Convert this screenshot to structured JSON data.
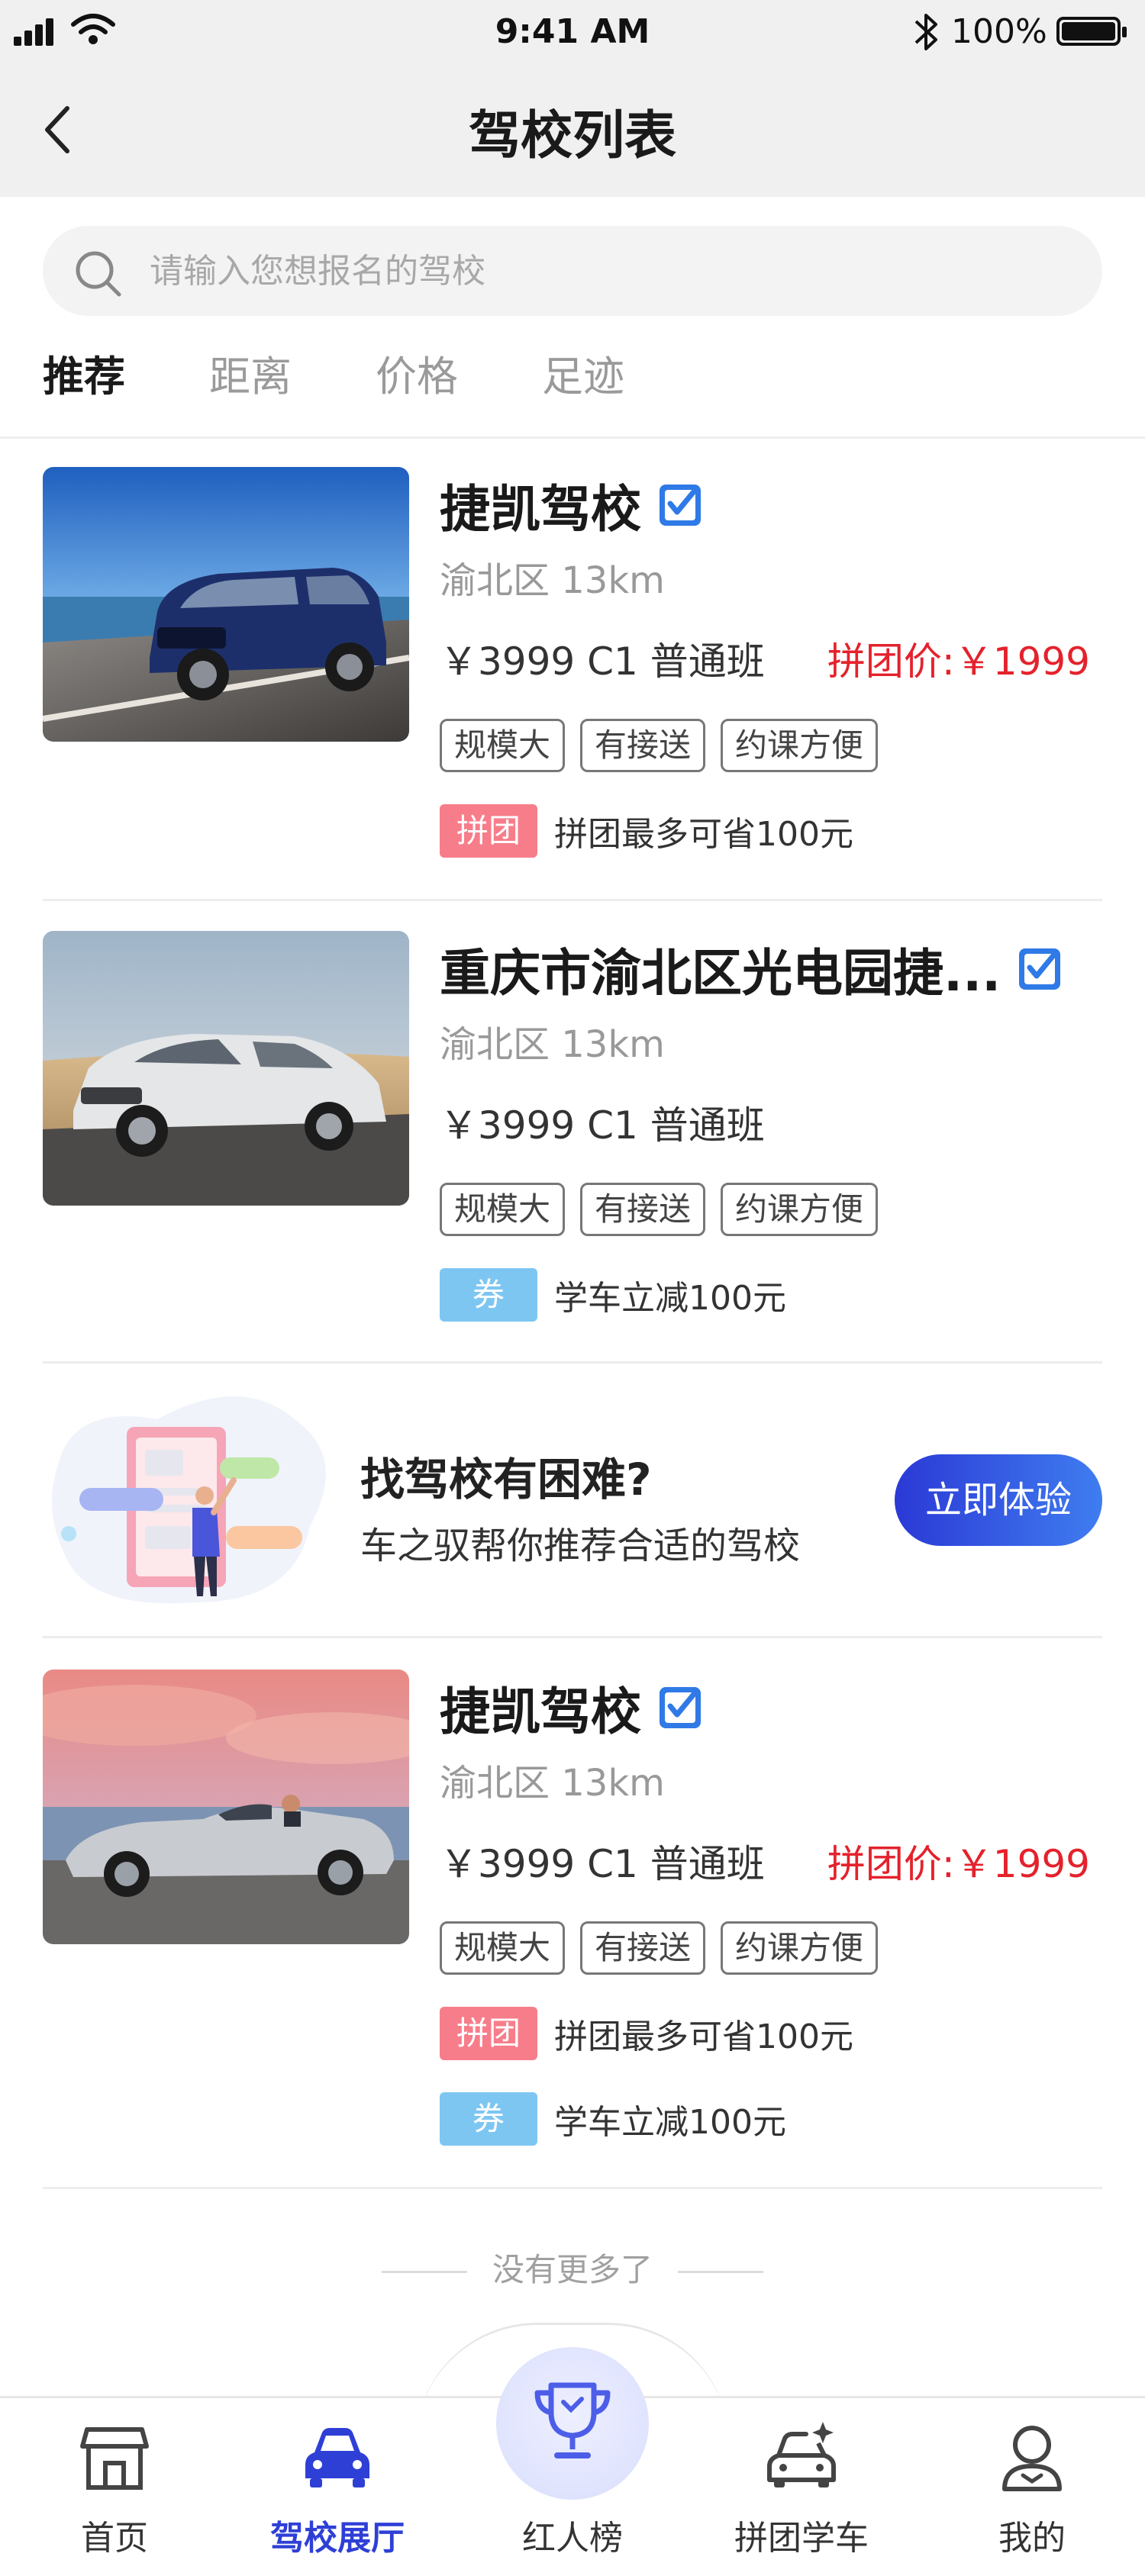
{
  "status_bar": {
    "time": "9:41 AM",
    "battery": "100%"
  },
  "header": {
    "title": "驾校列表"
  },
  "search": {
    "placeholder": "请输入您想报名的驾校"
  },
  "tabs": [
    {
      "label": "推荐",
      "active": true
    },
    {
      "label": "距离",
      "active": false
    },
    {
      "label": "价格",
      "active": false
    },
    {
      "label": "足迹",
      "active": false
    }
  ],
  "schools": [
    {
      "name": "捷凯驾校",
      "district": "渝北区 13km",
      "price": "￥3999 C1 普通班",
      "group_price": "拼团价:￥1999",
      "tags": [
        "规模大",
        "有接送",
        "约课方便"
      ],
      "promos": [
        {
          "badge": "拼团",
          "text": "拼团最多可省100元"
        }
      ]
    },
    {
      "name": "重庆市渝北区光电园捷...",
      "district": "渝北区 13km",
      "price": "￥3999 C1 普通班",
      "tags": [
        "规模大",
        "有接送",
        "约课方便"
      ],
      "promos": [
        {
          "badge": "券",
          "text": "学车立减100元"
        }
      ]
    },
    {
      "name": "捷凯驾校",
      "district": "渝北区 13km",
      "price": "￥3999 C1 普通班",
      "group_price": "拼团价:￥1999",
      "tags": [
        "规模大",
        "有接送",
        "约课方便"
      ],
      "promos": [
        {
          "badge": "拼团",
          "text": "拼团最多可省100元"
        },
        {
          "badge": "券",
          "text": "学车立减100元"
        }
      ]
    }
  ],
  "banner": {
    "title": "找驾校有困难?",
    "subtitle": "车之驭帮你推荐合适的驾校",
    "cta": "立即体验"
  },
  "list_end": "没有更多了",
  "bottom_nav": [
    {
      "label": "首页",
      "icon": "store-icon"
    },
    {
      "label": "驾校展厅",
      "icon": "car-icon",
      "active": true
    },
    {
      "label": "红人榜",
      "icon": "trophy-icon"
    },
    {
      "label": "拼团学车",
      "icon": "car-sparkle-icon"
    },
    {
      "label": "我的",
      "icon": "user-icon"
    }
  ],
  "colors": {
    "accent": "#2e3fd6",
    "price_red": "#e4222c",
    "badge_pink": "#f77d8b",
    "badge_blue": "#7dc6f2",
    "verify_blue": "#2f7ae6"
  }
}
